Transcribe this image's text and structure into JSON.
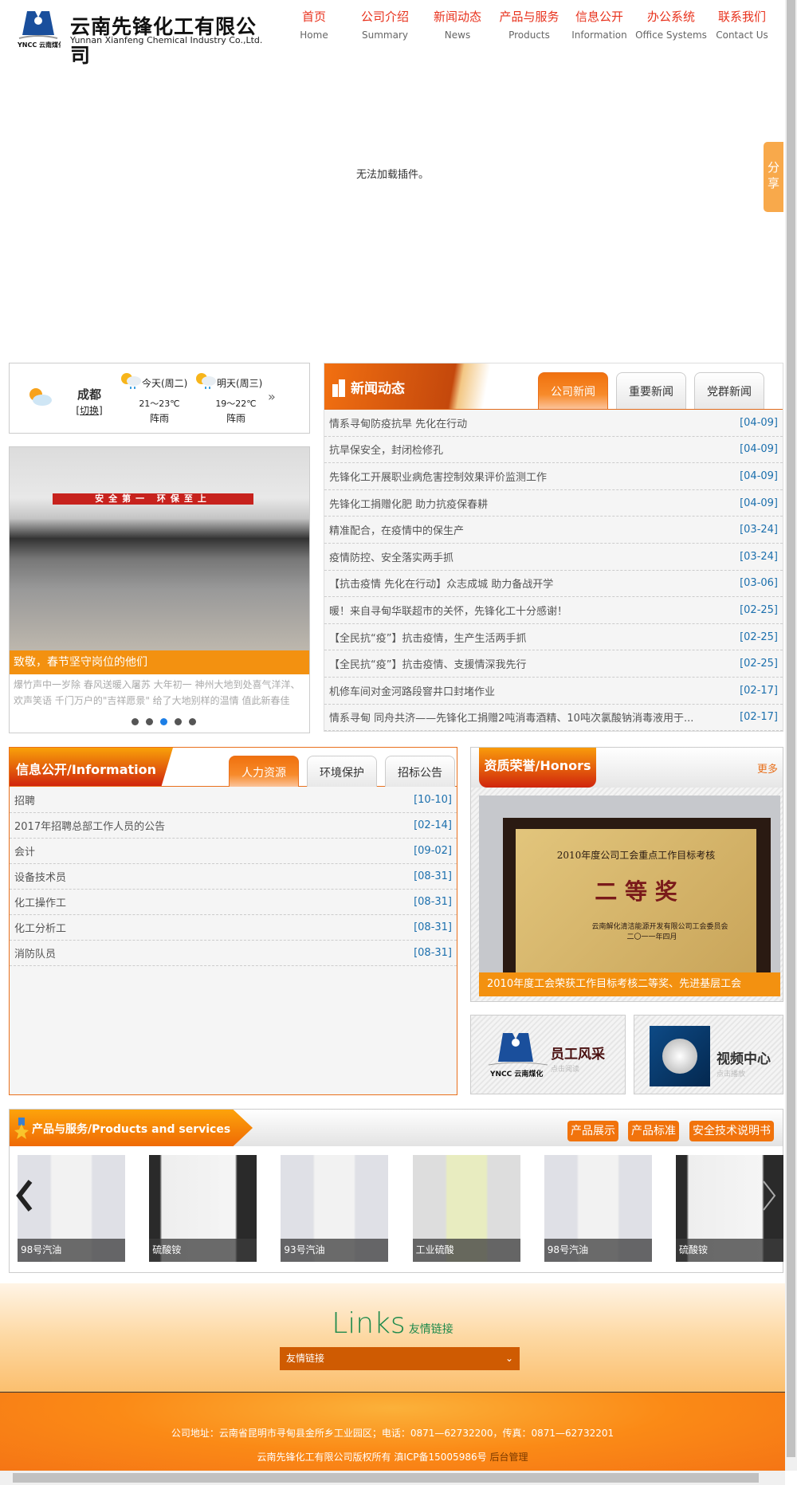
{
  "header": {
    "logo_cn": "云南先锋化工有限公司",
    "logo_en": "Yunnan Xianfeng Chemical Industry Co.,Ltd.",
    "logo_mark": "YNCC 云南煤化",
    "nav": [
      {
        "cn": "首页",
        "en": "Home"
      },
      {
        "cn": "公司介绍",
        "en": "Summary"
      },
      {
        "cn": "新闻动态",
        "en": "News"
      },
      {
        "cn": "产品与服务",
        "en": "Products"
      },
      {
        "cn": "信息公开",
        "en": "Information"
      },
      {
        "cn": "办公系统",
        "en": "Office Systems"
      },
      {
        "cn": "联系我们",
        "en": "Contact Us"
      }
    ]
  },
  "plugin_message": "无法加载插件。",
  "share_label": "分享",
  "weather": {
    "city": "成都",
    "switch": "[切换]",
    "today": {
      "label": "今天(周二)",
      "temp": "21～23℃",
      "desc": "阵雨"
    },
    "tomorrow": {
      "label": "明天(周三)",
      "temp": "19～22℃",
      "desc": "阵雨"
    },
    "more": "»"
  },
  "slider": {
    "banner": "安全第一 环保至上",
    "caption": "致敬，春节坚守岗位的他们",
    "desc": "爆竹声中一岁除 春风送暖入屠苏 大年初一 神州大地到处喜气洋洋、欢声笑语 千门万户的\"吉祥愿景\" 给了大地别样的温情 值此新春佳节.....",
    "active_dot": 3,
    "dot_count": 5
  },
  "news": {
    "title": "新闻动态",
    "tabs": [
      "公司新闻",
      "重要新闻",
      "党群新闻"
    ],
    "active_tab": 0,
    "items": [
      {
        "t": "情系寻甸防疫抗旱 先化在行动",
        "d": "[04-09]"
      },
      {
        "t": "抗旱保安全，封闭检修孔",
        "d": "[04-09]"
      },
      {
        "t": "先锋化工开展职业病危害控制效果评价监测工作",
        "d": "[04-09]"
      },
      {
        "t": "先锋化工捐赠化肥 助力抗疫保春耕",
        "d": "[04-09]"
      },
      {
        "t": "精准配合，在疫情中的保生产",
        "d": "[03-24]"
      },
      {
        "t": "疫情防控、安全落实两手抓",
        "d": "[03-24]"
      },
      {
        "t": "【抗击疫情 先化在行动】众志成城 助力备战开学",
        "d": "[03-06]"
      },
      {
        "t": "暖！来自寻甸华联超市的关怀，先锋化工十分感谢！",
        "d": "[02-25]"
      },
      {
        "t": "【全民抗“疫”】抗击疫情，生产生活两手抓",
        "d": "[02-25]"
      },
      {
        "t": "【全民抗“疫”】抗击疫情、支援情深我先行",
        "d": "[02-25]"
      },
      {
        "t": "机修车间对金河路段窨井口封堵作业",
        "d": "[02-17]"
      },
      {
        "t": "情系寻甸 同舟共济——先锋化工捐赠2吨消毒酒精、10吨次氯酸钠消毒液用于...",
        "d": "[02-17]"
      }
    ]
  },
  "info": {
    "title": "信息公开/Information",
    "tabs": [
      "人力资源",
      "环境保护",
      "招标公告"
    ],
    "active_tab": 0,
    "items": [
      {
        "t": "招聘",
        "d": "[10-10]"
      },
      {
        "t": "2017年招聘总部工作人员的公告",
        "d": "[02-14]"
      },
      {
        "t": "会计",
        "d": "[09-02]"
      },
      {
        "t": "设备技术员",
        "d": "[08-31]"
      },
      {
        "t": "化工操作工",
        "d": "[08-31]"
      },
      {
        "t": "化工分析工",
        "d": "[08-31]"
      },
      {
        "t": "消防队员",
        "d": "[08-31]"
      }
    ]
  },
  "honors": {
    "title": "资质荣誉/Honors",
    "more": "更多",
    "plaque_line1": "2010年度公司工会重点工作目标考核",
    "plaque_award": "二 等 奖",
    "plaque_org": "云南解化清洁能源开发有限公司工会委员会",
    "plaque_date": "二〇一一年四月",
    "caption": "2010年度工会荣获工作目标考核二等奖、先进基层工会"
  },
  "tiles": {
    "staff": {
      "title": "员工风采",
      "sub": "点击阅读",
      "mark": "YNCC 云南煤化"
    },
    "video": {
      "title": "视频中心",
      "sub": "点击播放"
    }
  },
  "products": {
    "title": "产品与服务/Products and services",
    "buttons": [
      "产品展示",
      "产品标准",
      "安全技术说明书"
    ],
    "items": [
      "98号汽油",
      "硫酸铵",
      "93号汽油",
      "工业硫酸",
      "98号汽油",
      "硫酸铵"
    ]
  },
  "links": {
    "title": "Links",
    "subtitle": "友情链接",
    "select_value": "友情链接"
  },
  "footer": {
    "address": "公司地址：云南省昆明市寻甸县金所乡工业园区；电话：0871—62732200，传真：0871—62732201",
    "copyright": "云南先锋化工有限公司版权所有  滇ICP备15005986号",
    "admin": "后台管理"
  },
  "colors": {
    "accent": "#f1730c",
    "nav_red": "#e8321d",
    "date_blue": "#1b6fad",
    "caption_orange": "#f39110"
  }
}
